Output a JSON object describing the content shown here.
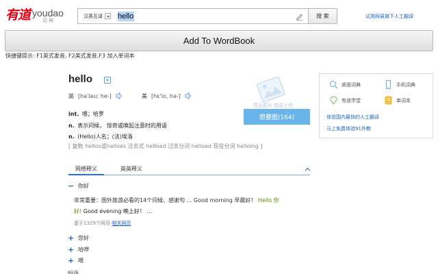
{
  "header": {
    "logo_cn": "有道",
    "logo_en": "youdao",
    "logo_sub": "词 典",
    "lang_select": "汉英互译",
    "query": "hello",
    "search_button": "搜 索",
    "human_translate_link": "试用网易旗下人工翻译"
  },
  "wordbook_button": "Add To WordBook",
  "shortcut_hint": "快捷键提示: F1英式发音, F2美式发音,F3 加入单词本",
  "word": "hello",
  "phonetics": {
    "uk_label": "英",
    "uk": "[həˈləu; he-]",
    "us_label": "美",
    "us": "[hɛˈlo, hə-]"
  },
  "definitions": [
    {
      "pos": "int.",
      "text": "喂；哈罗"
    },
    {
      "pos": "n.",
      "text": "表示问候， 惊奇或唤起注意时的用语"
    },
    {
      "pos": "n.",
      "text": "(Hello)人名；(法)埃洛"
    }
  ],
  "word_forms": "[ 复数 hellos或helloes 过去式 helloed 过去分词 helloed 现在分词 helloing ]",
  "image_panel": {
    "placeholder_text": "暂无图片 欢迎上传",
    "button_label": "想要图(164)"
  },
  "tabs": [
    {
      "label": "网络释义",
      "active": true
    },
    {
      "label": "英英释义",
      "active": false
    }
  ],
  "web_sense": {
    "title": "你好",
    "example_cn": "非常重要：国外旅游必看的14个问候、感谢句 ... Good morning 早晨好！",
    "example_hl_1": "Hello 你",
    "example_hl_2": "好!",
    "example_tail": "Good evening 晚上好！ ...",
    "source_prefix": "基于1329个网页-",
    "source_link": "相关网页"
  },
  "more_senses": [
    "您好",
    "哈啰",
    "喂"
  ],
  "cut_label": "短语",
  "sidebar": {
    "apps": [
      {
        "label": "桌面词典",
        "icon": "desktop-dict-icon"
      },
      {
        "label": "手机词典",
        "icon": "phone-dict-icon"
      },
      {
        "label": "有道学堂",
        "icon": "school-icon"
      },
      {
        "label": "单词本",
        "icon": "wordbook-icon"
      }
    ],
    "link_1": "体验国内最快的人工翻译",
    "link_2": "马上免费体验91外教"
  },
  "colors": {
    "brand_red": "#e60012",
    "link_blue": "#1a64c8",
    "image_button": "#69b5ea",
    "highlight_green": "#5a8d00"
  }
}
